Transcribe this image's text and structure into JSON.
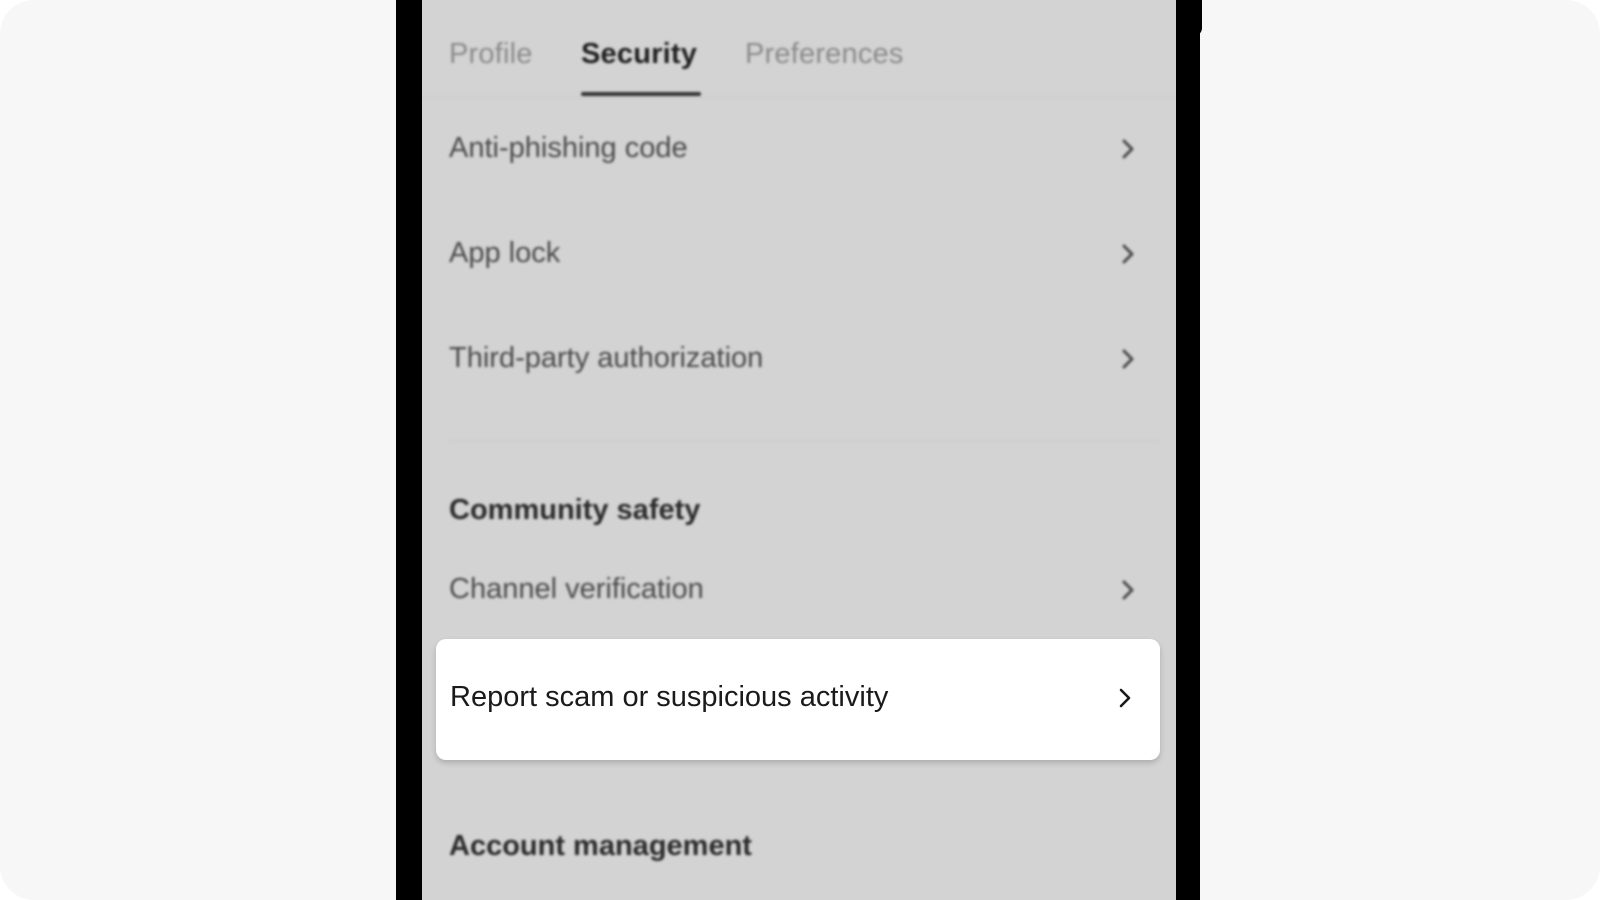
{
  "tabs": [
    {
      "label": "Profile"
    },
    {
      "label": "Security"
    },
    {
      "label": "Preferences"
    }
  ],
  "active_tab": "Security",
  "security_items": [
    {
      "label": "Anti-phishing code"
    },
    {
      "label": "App lock"
    },
    {
      "label": "Third-party authorization"
    }
  ],
  "community_safety": {
    "header": "Community safety",
    "items": [
      {
        "label": "Channel verification"
      },
      {
        "label": "Report scam or suspicious activity"
      }
    ]
  },
  "account_management": {
    "header": "Account management"
  },
  "icons": {
    "row_chevron": "chevron-right-icon"
  },
  "colors": {
    "overlay_dim": "#d3d3d3",
    "frame": "#000000",
    "highlight_card": "#ffffff",
    "active_tab_text": "#1f1f1f",
    "inactive_tab_text": "#8a8a8a"
  }
}
